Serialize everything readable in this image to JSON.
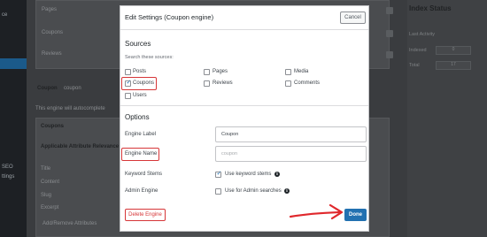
{
  "background": {
    "sidebar_items": [
      "ce",
      "SEO",
      "ttings"
    ],
    "main_rows": [
      "Pages",
      "Coupons",
      "Reviews"
    ],
    "engine_label": "Coupon",
    "engine_slug": "coupon",
    "engine_hint": "This engine will autocomplete",
    "source_section": "Coupons",
    "attribute_title": "Applicable Attribute Relevance",
    "attribute_fields": [
      "Title",
      "Content",
      "Slug",
      "Excerpt"
    ],
    "attribute_button": "Add/Remove Attributes"
  },
  "right_panel": {
    "title": "Index Status",
    "last_activity_label": "Last Activity",
    "indexed_label": "Indexed",
    "indexed_value": "0",
    "total_label": "Total",
    "total_value": "17"
  },
  "modal": {
    "title": "Edit Settings (Coupon engine)",
    "cancel_label": "Cancel",
    "sources_heading": "Sources",
    "sources_hint": "Search these sources:",
    "sources": [
      {
        "label": "Posts",
        "checked": false
      },
      {
        "label": "Pages",
        "checked": false
      },
      {
        "label": "Media",
        "checked": false
      },
      {
        "label": "Coupons",
        "checked": true
      },
      {
        "label": "Reviews",
        "checked": false
      },
      {
        "label": "Comments",
        "checked": false
      },
      {
        "label": "Users",
        "checked": false
      }
    ],
    "options_heading": "Options",
    "engine_label_label": "Engine Label",
    "engine_label_value": "Coupon",
    "engine_name_label": "Engine Name",
    "engine_name_value": "coupon",
    "keyword_stems_label": "Keyword Stems",
    "keyword_stems_text": "Use keyword stems",
    "keyword_stems_checked": true,
    "admin_engine_label": "Admin Engine",
    "admin_engine_text": "Use for Admin searches",
    "admin_engine_checked": false,
    "delete_label": "Delete Engine",
    "done_label": "Done"
  },
  "colors": {
    "accent": "#2271b1",
    "danger": "#d63638",
    "annotation": "#e0282c"
  }
}
